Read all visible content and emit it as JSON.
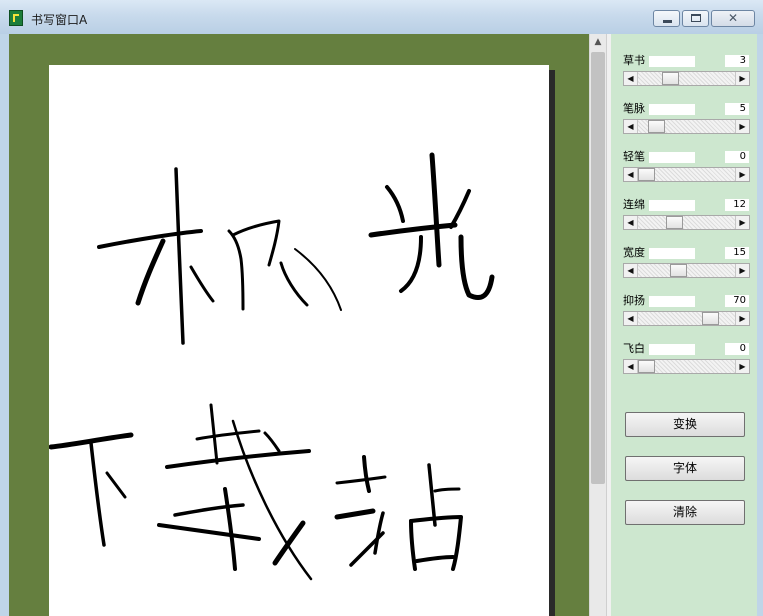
{
  "window": {
    "title": "书写窗口A"
  },
  "params": [
    {
      "label": "草书",
      "value": "3",
      "fill": 0.3
    },
    {
      "label": "笔脉",
      "value": "5",
      "fill": 0.12
    },
    {
      "label": "轻笔",
      "value": "0",
      "fill": 0.0
    },
    {
      "label": "连绵",
      "value": "12",
      "fill": 0.35
    },
    {
      "label": "宽度",
      "value": "15",
      "fill": 0.4
    },
    {
      "label": "抑扬",
      "value": "70",
      "fill": 0.8
    },
    {
      "label": "飞白",
      "value": "0",
      "fill": 0.0
    }
  ],
  "buttons": {
    "transform": "变换",
    "font": "字体",
    "clear": "清除"
  },
  "colors": {
    "canvas_bg": "#657f3f",
    "panel_bg": "#cde7cf",
    "ink": "#000000"
  },
  "icons": {
    "app": "app-icon",
    "minimize": "minimize-icon",
    "maximize": "maximize-icon",
    "close": "close-icon"
  }
}
